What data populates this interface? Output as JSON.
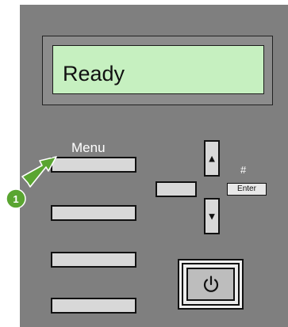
{
  "display": {
    "status_text": "Ready"
  },
  "labels": {
    "menu": "Menu",
    "hash": "#",
    "enter": "Enter"
  },
  "navigation": {
    "up_glyph": "▲",
    "down_glyph": "▼"
  },
  "callout": {
    "number": "1",
    "color": "#5aa531"
  },
  "icons": {
    "power": "power-icon",
    "callout_arrow": "arrow-icon"
  }
}
